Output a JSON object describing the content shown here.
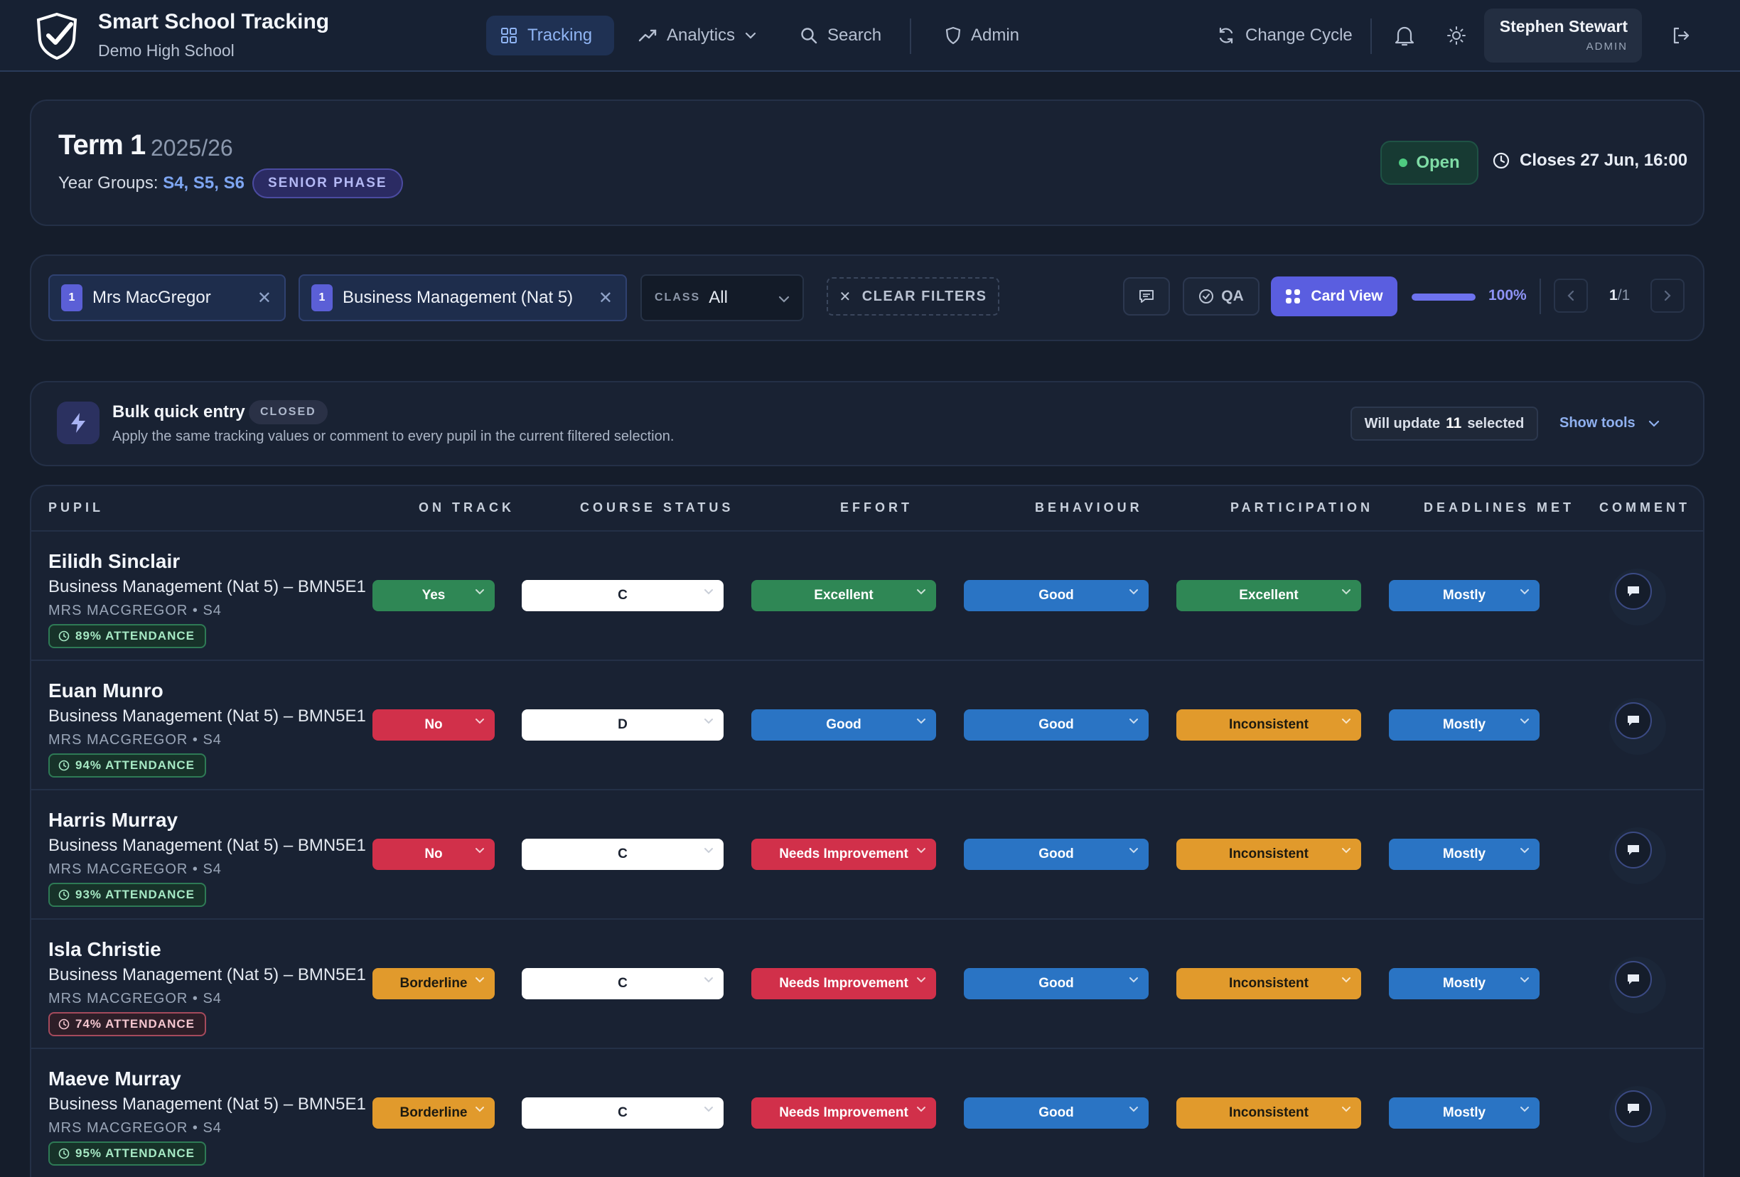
{
  "brand": {
    "title": "Smart School Tracking",
    "subtitle": "Demo High School"
  },
  "nav": {
    "tracking": "Tracking",
    "analytics": "Analytics",
    "search": "Search",
    "admin": "Admin",
    "change_cycle": "Change Cycle"
  },
  "user": {
    "name": "Stephen Stewart",
    "role": "ADMIN"
  },
  "term": {
    "title": "Term 1",
    "year": "2025/26",
    "year_groups_label": "Year Groups:",
    "year_groups": "S4, S5, S6",
    "phase": "SENIOR PHASE",
    "status": "Open",
    "closes": "Closes 27 Jun, 16:00"
  },
  "filters": {
    "teacher": {
      "count": "1",
      "label": "Mrs MacGregor"
    },
    "course": {
      "count": "1",
      "label": "Business Management (Nat 5)"
    },
    "class_label": "CLASS",
    "class_value": "All",
    "clear": "CLEAR FILTERS",
    "qa": "QA",
    "card_view": "Card View",
    "progress": 1.0,
    "progress_text": "100%",
    "page_current": "1",
    "page_total": "/1"
  },
  "bulk": {
    "title": "Bulk quick entry",
    "badge": "CLOSED",
    "description": "Apply the same tracking values or comment to every pupil in the current filtered selection.",
    "will_update_prefix": "Will update",
    "will_update_count": "11",
    "will_update_suffix": "selected",
    "show_tools": "Show tools"
  },
  "table": {
    "headers": {
      "pupil": "PUPIL",
      "on_track": "ON TRACK",
      "course_status": "COURSE STATUS",
      "effort": "EFFORT",
      "behaviour": "BEHAVIOUR",
      "participation": "PARTICIPATION",
      "deadlines": "DEADLINES MET",
      "comment": "COMMENT"
    },
    "rows": [
      {
        "name": "Eilidh Sinclair",
        "course": "Business Management (Nat 5) – BMN5E1",
        "teacher": "MRS MACGREGOR • S4",
        "attendance": "89% ATTENDANCE",
        "on_track": "Yes",
        "course_status": "C",
        "effort": "Excellent",
        "behaviour": "Good",
        "participation": "Excellent",
        "deadlines": "Mostly"
      },
      {
        "name": "Euan Munro",
        "course": "Business Management (Nat 5) – BMN5E1",
        "teacher": "MRS MACGREGOR • S4",
        "attendance": "94% ATTENDANCE",
        "on_track": "No",
        "course_status": "D",
        "effort": "Good",
        "behaviour": "Good",
        "participation": "Inconsistent",
        "deadlines": "Mostly"
      },
      {
        "name": "Harris Murray",
        "course": "Business Management (Nat 5) – BMN5E1",
        "teacher": "MRS MACGREGOR • S4",
        "attendance": "93% ATTENDANCE",
        "on_track": "No",
        "course_status": "C",
        "effort": "Needs Improvement",
        "behaviour": "Good",
        "participation": "Inconsistent",
        "deadlines": "Mostly"
      },
      {
        "name": "Isla Christie",
        "course": "Business Management (Nat 5) – BMN5E1",
        "teacher": "MRS MACGREGOR • S4",
        "attendance": "74% ATTENDANCE",
        "on_track": "Borderline",
        "course_status": "C",
        "effort": "Needs Improvement",
        "behaviour": "Good",
        "participation": "Inconsistent",
        "deadlines": "Mostly"
      },
      {
        "name": "Maeve Murray",
        "course": "Business Management (Nat 5) – BMN5E1",
        "teacher": "MRS MACGREGOR • S4",
        "attendance": "95% ATTENDANCE",
        "on_track": "Borderline",
        "course_status": "C",
        "effort": "Needs Improvement",
        "behaviour": "Good",
        "participation": "Inconsistent",
        "deadlines": "Mostly"
      }
    ]
  },
  "colors": {
    "green": "#2f8755",
    "red": "#d1304a",
    "amber": "#e19a2c",
    "blue": "#2a74c4",
    "accent": "#5a5ee0"
  },
  "icons": {
    "logo": "shield-check-logo",
    "tracking": "grid-icon",
    "analytics": "trend-icon",
    "search": "search-icon",
    "admin": "shield-icon",
    "change_cycle": "refresh-icon",
    "bell": "bell-icon",
    "theme": "sun-icon",
    "logout": "logout-icon",
    "comment": "comment-icon",
    "bolt": "bolt-icon"
  }
}
